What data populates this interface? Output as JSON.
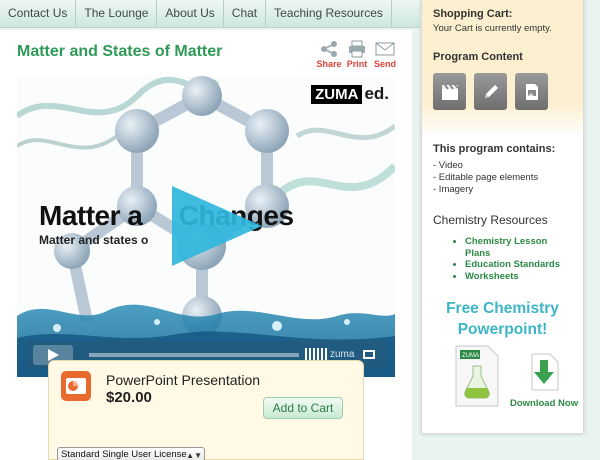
{
  "nav": {
    "items": [
      "Contact Us",
      "The Lounge",
      "About Us",
      "Chat",
      "Teaching Resources"
    ]
  },
  "page": {
    "title": "Matter and States of Matter",
    "tools": {
      "share": "Share",
      "print": "Print",
      "send": "Send"
    }
  },
  "video": {
    "brand": "ZUMA",
    "brand_suffix": "ed.",
    "title_text": "Matter a     Changes",
    "subtitle_text": "Matter and states o",
    "player_logo": "zuma"
  },
  "product": {
    "title": "PowerPoint Presentation",
    "price": "$20.00",
    "add_button": "Add to Cart",
    "license": "Standard Single User License"
  },
  "sidebar": {
    "cart_heading": "Shopping Cart:",
    "cart_status": "Your Cart is currently empty.",
    "program_heading": "Program Content",
    "program_icons": [
      "video-clapper-icon",
      "pencil-edit-icon",
      "document-image-icon"
    ],
    "contains_heading": "This program contains:",
    "contains_items": [
      "- Video",
      "- Editable page elements",
      "- Imagery"
    ],
    "resources_heading": "Chemistry Resources",
    "resources_links": [
      "Chemistry Lesson Plans",
      "Education Standards",
      "Worksheets"
    ],
    "promo_line1": "Free Chemistry",
    "promo_line2": "Powerpoint!",
    "promo_doc_badge": "ZUMA ed",
    "download_label": "Download Now"
  },
  "colors": {
    "accent_green": "#2f9a58",
    "promo_teal": "#3db5c7",
    "tool_red": "#d9453a"
  }
}
